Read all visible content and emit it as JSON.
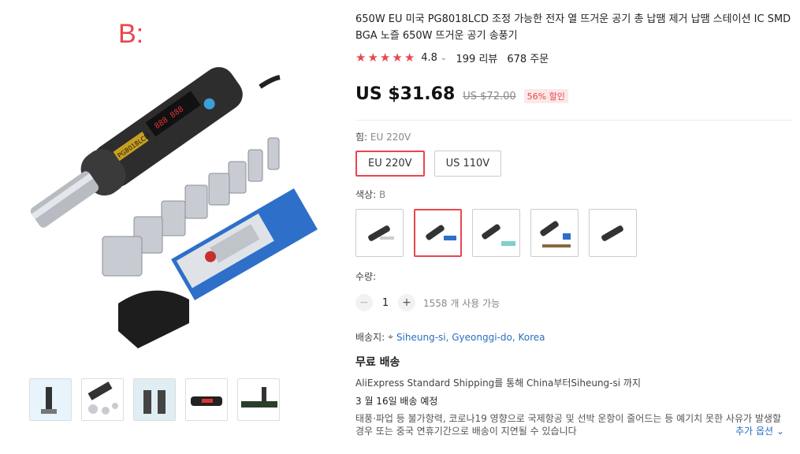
{
  "gallery": {
    "variant_letter": "B:",
    "thumbnail_icons": [
      "product-thumb-1",
      "product-thumb-2",
      "product-thumb-3",
      "product-thumb-4",
      "product-thumb-5"
    ]
  },
  "product": {
    "title": "650W EU 미국 PG8018LCD 조정 가능한 전자 열 뜨거운 공기 총 납땜 제거 납땜 스테이션 IC SMD BGA 노즐 650W 뜨거운 공기 송풍기",
    "rating": "4.8",
    "reviews": "199 리뷰",
    "orders": "678 주문",
    "price": "US $31.68",
    "original_price": "US $72.00",
    "discount": "56% 할인"
  },
  "power": {
    "label": "힘:",
    "selected": "EU 220V",
    "options": [
      "EU 220V",
      "US 110V"
    ]
  },
  "color": {
    "label": "색상:",
    "selected": "B",
    "options_count_note": "5 swatches, 2nd selected"
  },
  "quantity": {
    "label": "수량:",
    "minus": "−",
    "value": "1",
    "plus": "+",
    "available": "1558 개 사용 가능"
  },
  "shipping": {
    "dest_label": "배송지:",
    "dest_value": "Siheung-si, Gyeonggi-do, Korea",
    "title": "무료 배송",
    "method": "AliExpress Standard Shipping를 통해 China부터Siheung-si 까지",
    "date": "3 월 16일 배송 예정",
    "note": "태풍·파업 등 불가항력, 코로나19 영향으로 국제항공 및 선박 운항이 줄어드는 등 예기치 못한 사유가 발생할 경우 또는 중국 연휴기간으로 배송이 지연될 수 있습니다",
    "more": "추가 옵션"
  },
  "colors": {
    "accent": "#e8464f",
    "link": "#2a6fbf"
  }
}
